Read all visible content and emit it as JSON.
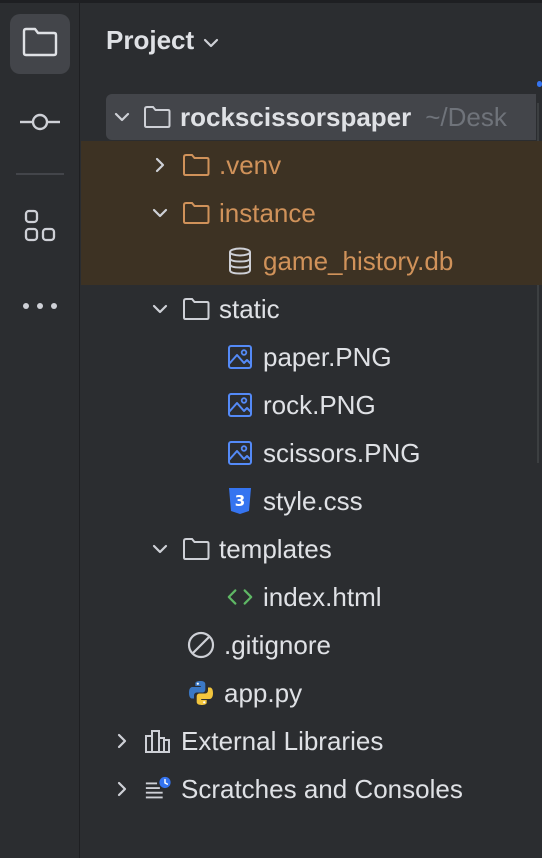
{
  "panel": {
    "title": "Project"
  },
  "tree": {
    "root": {
      "label": "rockscissorspaper",
      "path_hint": "~/Desk"
    },
    "items": [
      {
        "label": ".venv",
        "icon": "folder-icon"
      },
      {
        "label": "instance",
        "icon": "folder-icon"
      },
      {
        "label": "game_history.db",
        "icon": "database-icon"
      },
      {
        "label": "static",
        "icon": "folder-icon"
      },
      {
        "label": "paper.PNG",
        "icon": "image-icon"
      },
      {
        "label": "rock.PNG",
        "icon": "image-icon"
      },
      {
        "label": "scissors.PNG",
        "icon": "image-icon"
      },
      {
        "label": "style.css",
        "icon": "css-icon"
      },
      {
        "label": "templates",
        "icon": "folder-icon"
      },
      {
        "label": "index.html",
        "icon": "html-icon"
      },
      {
        "label": ".gitignore",
        "icon": "ignore-icon"
      },
      {
        "label": "app.py",
        "icon": "python-icon"
      },
      {
        "label": "External Libraries",
        "icon": "library-icon"
      },
      {
        "label": "Scratches and Consoles",
        "icon": "scratches-icon"
      }
    ]
  },
  "colors": {
    "background": "#2b2d30",
    "selection": "#43454a",
    "excluded_background": "#3d3223",
    "excluded_text": "#d0925a",
    "text": "#dfe1e5",
    "hint": "#6f737a",
    "accent": "#3574f0"
  }
}
